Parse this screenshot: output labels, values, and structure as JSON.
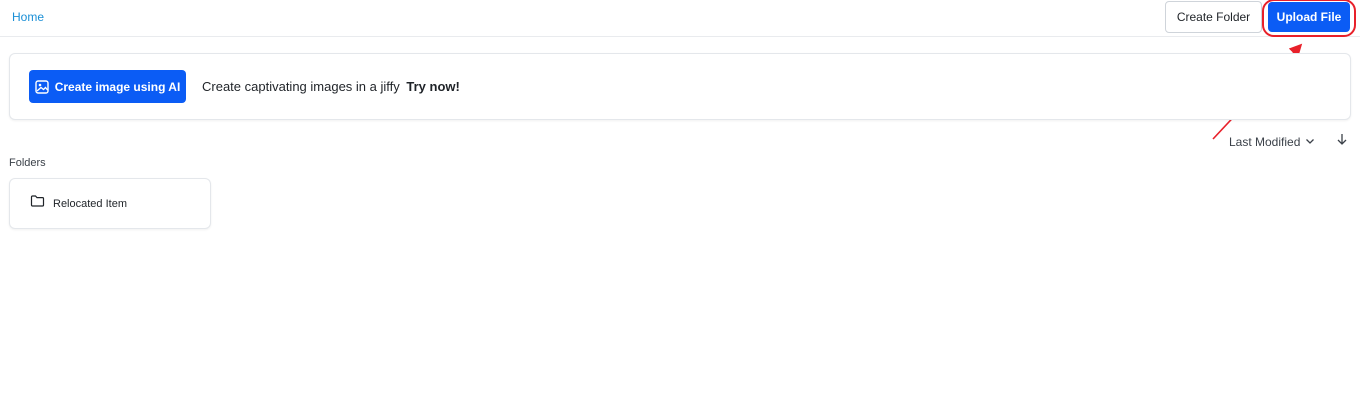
{
  "breadcrumb": {
    "home": "Home"
  },
  "toolbar": {
    "create_folder_label": "Create Folder",
    "upload_file_label": "Upload File"
  },
  "banner": {
    "ai_button_label": "Create image using AI",
    "message": "Create captivating images in a jiffy",
    "cta": "Try now!"
  },
  "sort": {
    "label": "Last Modified",
    "direction": "descending"
  },
  "folders_section": {
    "title": "Folders",
    "items": [
      {
        "name": "Relocated Item"
      }
    ]
  },
  "colors": {
    "primary": "#0b5cf5",
    "link": "#1a8fd6",
    "annotation": "#e8202a"
  },
  "icons": {
    "ai_button": "image-icon",
    "sort": "chevron-down-icon",
    "sort_direction": "arrow-down-icon",
    "folder": "folder-icon"
  }
}
